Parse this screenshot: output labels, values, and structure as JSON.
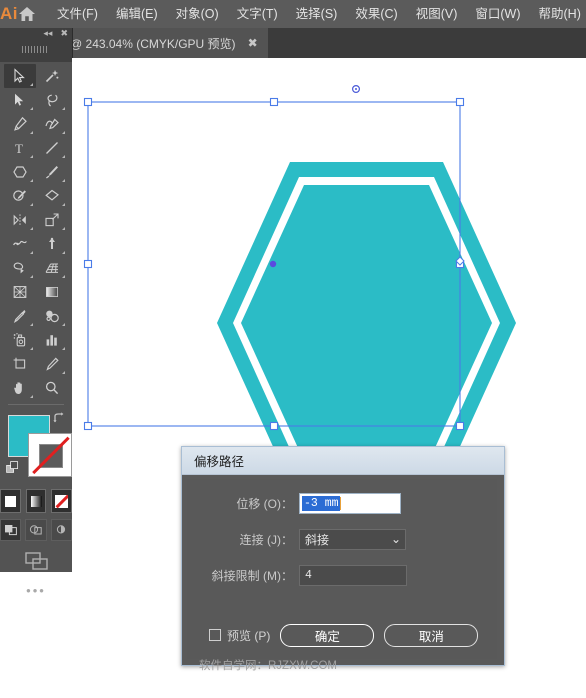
{
  "app": {
    "name": "Ai",
    "home_icon": "home-icon"
  },
  "menubar": {
    "items": [
      {
        "label": "文件(F)"
      },
      {
        "label": "编辑(E)"
      },
      {
        "label": "对象(O)"
      },
      {
        "label": "文字(T)"
      },
      {
        "label": "选择(S)"
      },
      {
        "label": "效果(C)"
      },
      {
        "label": "视图(V)"
      },
      {
        "label": "窗口(W)"
      },
      {
        "label": "帮助(H)"
      }
    ]
  },
  "tabbar": {
    "document_tab": {
      "title": "@ 243.04% (CMYK/GPU 预览)",
      "close": "✖"
    },
    "panel_stub": {
      "collapse": "◂◂",
      "close": "✖"
    }
  },
  "toolbar": {
    "tools": [
      {
        "name": "selection-tool",
        "active": true
      },
      {
        "name": "magic-wand-tool",
        "active": false
      },
      {
        "name": "direct-selection-tool",
        "active": false
      },
      {
        "name": "lasso-tool",
        "active": false
      },
      {
        "name": "pen-tool",
        "active": false
      },
      {
        "name": "curvature-tool",
        "active": false
      },
      {
        "name": "type-tool",
        "active": false
      },
      {
        "name": "line-segment-tool",
        "active": false
      },
      {
        "name": "shape-tool",
        "active": false
      },
      {
        "name": "paintbrush-tool",
        "active": false
      },
      {
        "name": "shaper-tool",
        "active": false
      },
      {
        "name": "eraser-tool",
        "active": false
      },
      {
        "name": "reflect-tool",
        "active": false
      },
      {
        "name": "scale-tool",
        "active": false
      },
      {
        "name": "width-tool",
        "active": false
      },
      {
        "name": "free-transform-tool",
        "active": false
      },
      {
        "name": "shape-builder-tool",
        "active": false
      },
      {
        "name": "perspective-grid-tool",
        "active": false
      },
      {
        "name": "mesh-tool",
        "active": false
      },
      {
        "name": "gradient-tool",
        "active": false
      },
      {
        "name": "eyedropper-tool",
        "active": false
      },
      {
        "name": "blend-tool",
        "active": false
      },
      {
        "name": "symbol-sprayer-tool",
        "active": false
      },
      {
        "name": "column-graph-tool",
        "active": false
      },
      {
        "name": "artboard-tool",
        "active": false
      },
      {
        "name": "slice-tool",
        "active": false
      },
      {
        "name": "hand-tool",
        "active": false
      },
      {
        "name": "zoom-tool",
        "active": false
      }
    ],
    "fill_color": "#2bbcc6",
    "stroke_color": "none",
    "dots": "•••"
  },
  "artwork": {
    "shape": "hexagon",
    "fill_color": "#2bbcc6",
    "gap_color": "#ffffff",
    "selection_color": "#4a7ce8",
    "center_point_color": "#5a4ae0"
  },
  "dialog": {
    "title": "偏移路径",
    "offset": {
      "label": "位移 (O)：",
      "value": "-3 mm"
    },
    "joins": {
      "label": "连接 (J)：",
      "value": "斜接",
      "chevron": "⌄"
    },
    "miter_limit": {
      "label": "斜接限制 (M)：",
      "value": "4"
    },
    "preview": {
      "label": "预览 (P)",
      "checked": false
    },
    "ok_button": "确定",
    "cancel_button": "取消",
    "watermark": "软件自学网：RJZXW.COM"
  }
}
